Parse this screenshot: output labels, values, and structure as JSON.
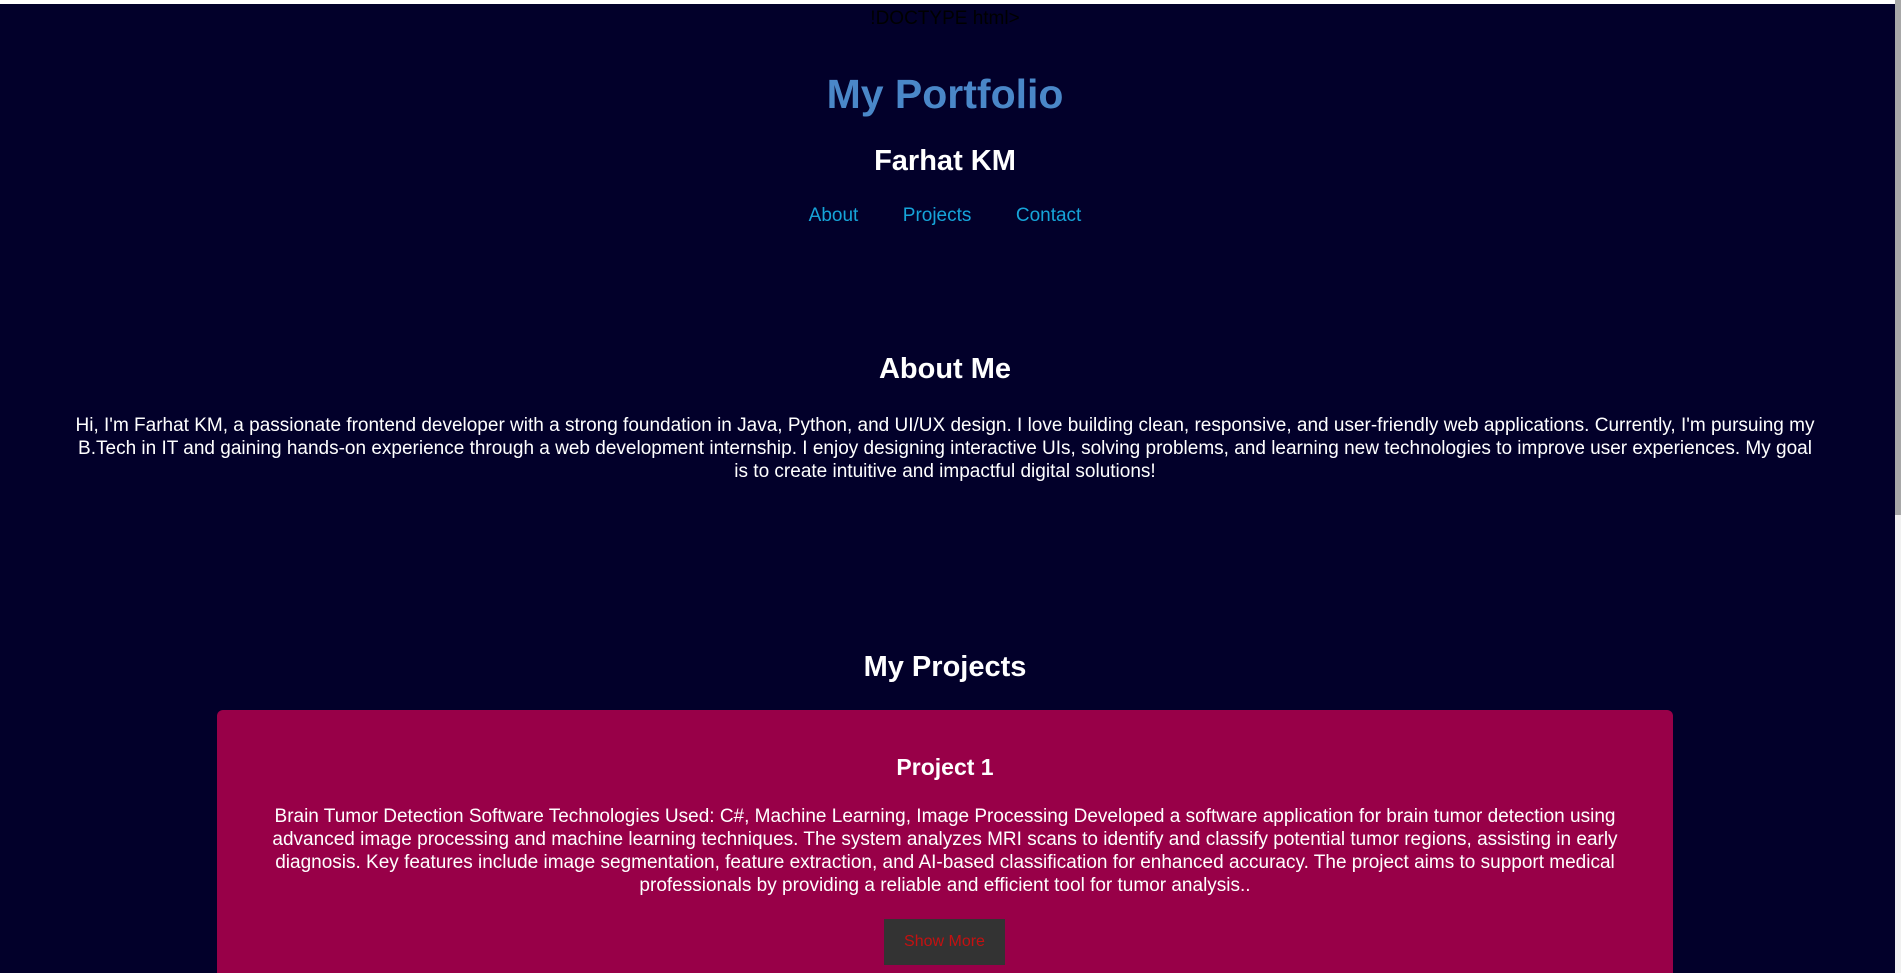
{
  "page": {
    "doctype_text": "!DOCTYPE html>"
  },
  "header": {
    "title": "My Portfolio",
    "name": "Farhat KM",
    "nav": [
      {
        "label": "About"
      },
      {
        "label": "Projects"
      },
      {
        "label": "Contact"
      }
    ]
  },
  "about": {
    "heading": "About Me",
    "text": "Hi, I'm Farhat KM, a passionate frontend developer with a strong foundation in Java, Python, and UI/UX design. I love building clean, responsive, and user-friendly web applications. Currently, I'm pursuing my B.Tech in IT and gaining hands-on experience through a web development internship. I enjoy designing interactive UIs, solving problems, and learning new technologies to improve user experiences. My goal is to create intuitive and impactful digital solutions!"
  },
  "projects": {
    "heading": "My Projects",
    "items": [
      {
        "title": "Project 1",
        "description": "Brain Tumor Detection Software Technologies Used: C#, Machine Learning, Image Processing Developed a software application for brain tumor detection using advanced image processing and machine learning techniques. The system analyzes MRI scans to identify and classify potential tumor regions, assisting in early diagnosis. Key features include image segmentation, feature extraction, and AI-based classification for enhanced accuracy. The project aims to support medical professionals by providing a reliable and efficient tool for tumor analysis..",
        "button_label": "Show More"
      }
    ]
  },
  "colors": {
    "background": "#02002a",
    "title": "#4a87c8",
    "nav_link": "#16a4d9",
    "project_card": "#980048",
    "button_bg": "#333333",
    "button_text": "#c41111"
  }
}
